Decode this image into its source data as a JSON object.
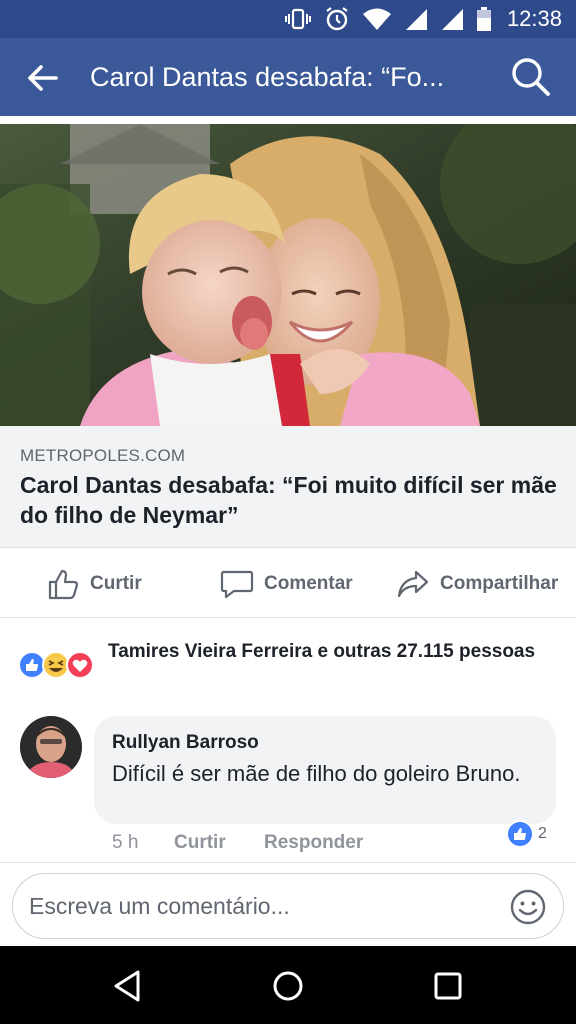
{
  "status_bar": {
    "time": "12:38",
    "icons": [
      "vibrate-icon",
      "alarm-icon",
      "wifi-icon",
      "signal-icon",
      "signal-icon",
      "battery-icon"
    ]
  },
  "header": {
    "title": "Carol Dantas desabafa: “Fo...",
    "back_icon": "back-arrow-icon",
    "search_icon": "search-icon"
  },
  "post": {
    "link": {
      "domain": "METROPOLES.COM",
      "headline": "Carol Dantas desabafa: “Foi muito difícil ser mãe do filho de Neymar”"
    },
    "actions": [
      {
        "label": "Curtir",
        "icon": "like-icon"
      },
      {
        "label": "Comentar",
        "icon": "comment-icon"
      },
      {
        "label": "Compartilhar",
        "icon": "share-icon"
      }
    ],
    "reactions": {
      "icons": [
        "like-reaction-icon",
        "haha-reaction-icon",
        "love-reaction-icon"
      ],
      "summary": "Tamires Vieira Ferreira e outras 27.115 pessoas"
    }
  },
  "comment": {
    "author": "Rullyan Barroso",
    "text": "Difícil é ser mãe de filho do goleiro Bruno.",
    "time": "5 h",
    "like_label": "Curtir",
    "reply_label": "Responder",
    "likes": "2"
  },
  "composer": {
    "placeholder": "Escreva um comentário..."
  },
  "colors": {
    "facebook_blue": "#3b5998",
    "status_bar": "#2f4a8a",
    "like_blue": "#4080ff",
    "love_red": "#f33e58"
  }
}
